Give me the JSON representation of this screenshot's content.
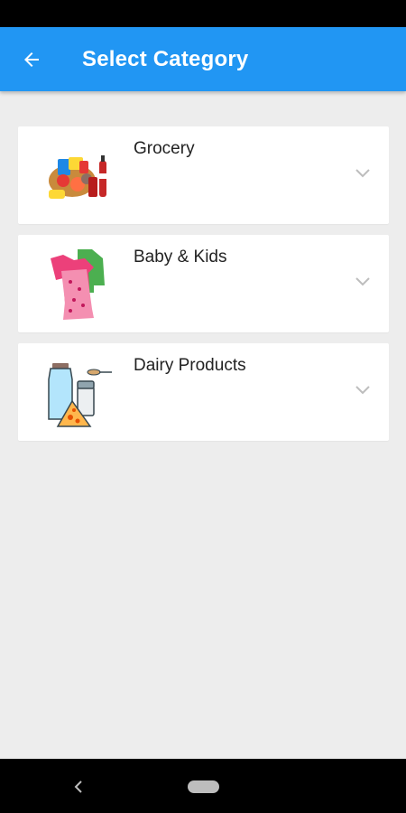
{
  "header": {
    "title": "Select Category",
    "back_icon": "arrow-left-icon"
  },
  "categories": [
    {
      "label": "Grocery",
      "image": "grocery-image",
      "icon": "chevron-down-icon"
    },
    {
      "label": "Baby & Kids",
      "image": "baby-kids-clothes-image",
      "icon": "chevron-down-icon"
    },
    {
      "label": "Dairy Products",
      "image": "dairy-products-image",
      "icon": "chevron-down-icon"
    }
  ],
  "navigation": {
    "back_icon": "nav-back-icon",
    "home_icon": "nav-home-pill"
  },
  "colors": {
    "app_bar": "#2196f3",
    "background": "#ededed",
    "card": "#ffffff"
  }
}
